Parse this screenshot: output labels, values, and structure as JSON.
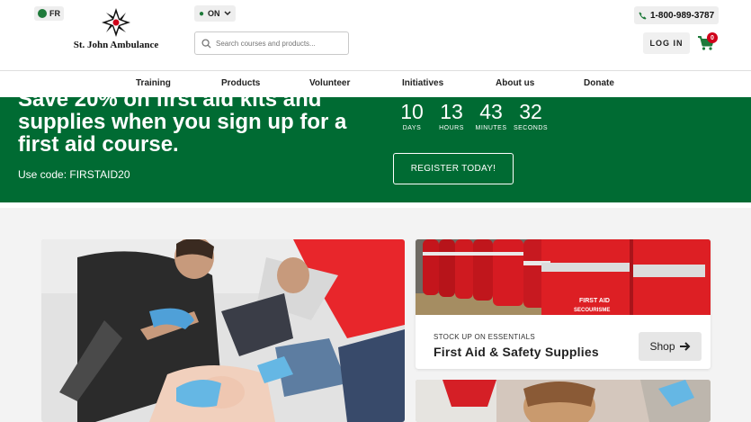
{
  "header": {
    "lang_label": "FR",
    "logo_text": "St. John Ambulance",
    "province_label": "ON",
    "search_placeholder": "Search courses and products...",
    "phone": "1-800-989-3787",
    "login_label": "LOG IN",
    "cart_count": "0"
  },
  "nav": {
    "items": [
      "Training",
      "Products",
      "Volunteer",
      "Initiatives",
      "About us",
      "Donate"
    ]
  },
  "promo": {
    "headline": "Save 20% on first aid kits and supplies when you sign up for a first aid course.",
    "code_text": "Use code: FIRSTAID20",
    "countdown": [
      {
        "value": "10",
        "label": "DAYS"
      },
      {
        "value": "13",
        "label": "HOURS"
      },
      {
        "value": "43",
        "label": "MINUTES"
      },
      {
        "value": "32",
        "label": "SECONDS"
      }
    ],
    "register_label": "REGISTER TODAY!"
  },
  "cards": {
    "supplies": {
      "kicker": "STOCK UP ON ESSENTIALS",
      "title": "First Aid & Safety Supplies",
      "button_label": "Shop",
      "image_text_1": "FIRST AID",
      "image_text_2": "SECOURISME"
    }
  },
  "colors": {
    "brand_green": "#006b33",
    "brand_red": "#d0021b"
  }
}
